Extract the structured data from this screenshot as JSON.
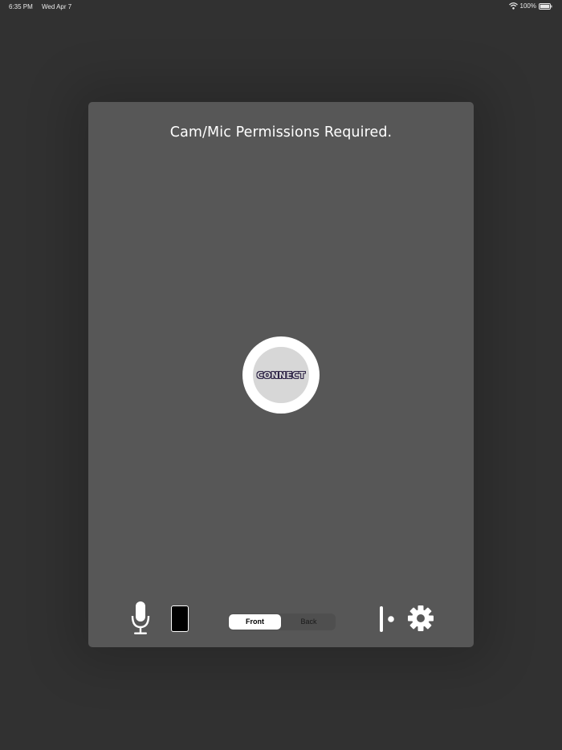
{
  "status_bar": {
    "time": "6:35 PM",
    "date": "Wed Apr 7",
    "battery_percent": "100%",
    "wifi_icon": "wifi-icon",
    "battery_icon": "battery-icon"
  },
  "panel": {
    "title": "Cam/Mic Permissions Required.",
    "connect_label": "CONNECT"
  },
  "controls": {
    "mic_icon": "microphone-icon",
    "camera_icon": "camera-preview-icon",
    "camera_segments": [
      "Front",
      "Back"
    ],
    "selected_segment": "Front",
    "align_icon": "align-icon",
    "settings_icon": "gear-icon"
  },
  "colors": {
    "background": "#313131",
    "panel": "#575757",
    "connect_ring": "#ffffff",
    "connect_fill": "#d7d7d7",
    "connect_text_outline": "#2d2346"
  }
}
